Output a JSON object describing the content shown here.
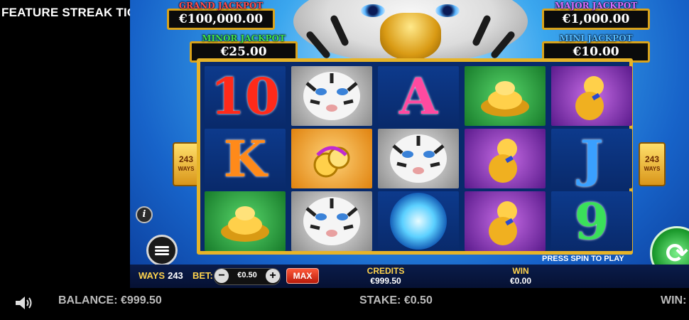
{
  "title": "FEATURE STREAK TIGER",
  "jackpots": {
    "grand": {
      "label": "GRAND JACKPOT",
      "value": "€100,000.00",
      "color": "#ff4a4a"
    },
    "major": {
      "label": "MAJOR JACKPOT",
      "value": "€1,000.00",
      "color": "#d86bff"
    },
    "minor": {
      "label": "MINOR JACKPOT",
      "value": "€25.00",
      "color": "#3fe04d"
    },
    "mini": {
      "label": "MINI JACKPOT",
      "value": "€10.00",
      "color": "#52b8ff"
    }
  },
  "reels": [
    [
      "10",
      "tiger",
      "A",
      "gold-ingot",
      "gourd"
    ],
    [
      "K",
      "coin-charm",
      "tiger",
      "gourd",
      "J"
    ],
    [
      "gold-ingot",
      "tiger",
      "orb",
      "gourd",
      "9"
    ]
  ],
  "ways_badge": {
    "num": "243",
    "word": "WAYS"
  },
  "controls": {
    "ways_label": "WAYS",
    "ways_value": "243",
    "bet_label": "BET:",
    "bet_value": "€0.50",
    "max_label": "MAX",
    "credits_label": "CREDITS",
    "credits_value": "€999.50",
    "win_label": "WIN",
    "win_value": "€0.00",
    "press_spin": "PRESS SPIN TO PLAY"
  },
  "footer": {
    "balance": "BALANCE: €999.50",
    "stake": "STAKE: €0.50",
    "win": "WIN:"
  },
  "colors": {
    "gold": "#e7b428",
    "accent": "#ffd34d",
    "spin": "#1b9a2c"
  }
}
